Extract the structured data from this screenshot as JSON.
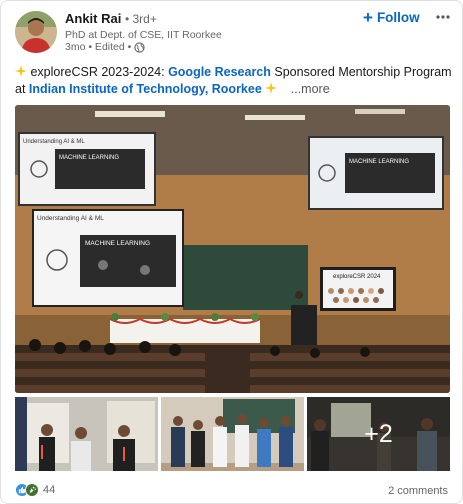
{
  "author": {
    "name": "Ankit Rai",
    "degree": "• 3rd+",
    "headline": "PhD at Dept. of CSE, IIT Roorkee",
    "meta": "3mo • Edited •"
  },
  "actions": {
    "follow_label": "Follow",
    "more_icon": "ellipsis-icon"
  },
  "post": {
    "intro": "exploreCSR 2023-2024: ",
    "link1": "Google Research",
    "middle": " Sponsored Mentorship Program at ",
    "link2": "Indian Institute of Technology, Roorkee",
    "see_more": "...more"
  },
  "slides": {
    "left_title": "Understanding AI & ML",
    "left_heading": "MACHINE LEARNING",
    "right_heading": "MACHINE LEARNING",
    "center_title": "Understanding AI & ML",
    "center_heading": "MACHINE LEARNING",
    "tv_title": "exploreCSR 2024"
  },
  "gallery": {
    "more_count": "+2"
  },
  "footer": {
    "reactions_count": "44",
    "comments": "2 comments"
  },
  "colors": {
    "accent": "#0a66c2",
    "like": "#378fe9",
    "celebrate": "#44712e"
  }
}
